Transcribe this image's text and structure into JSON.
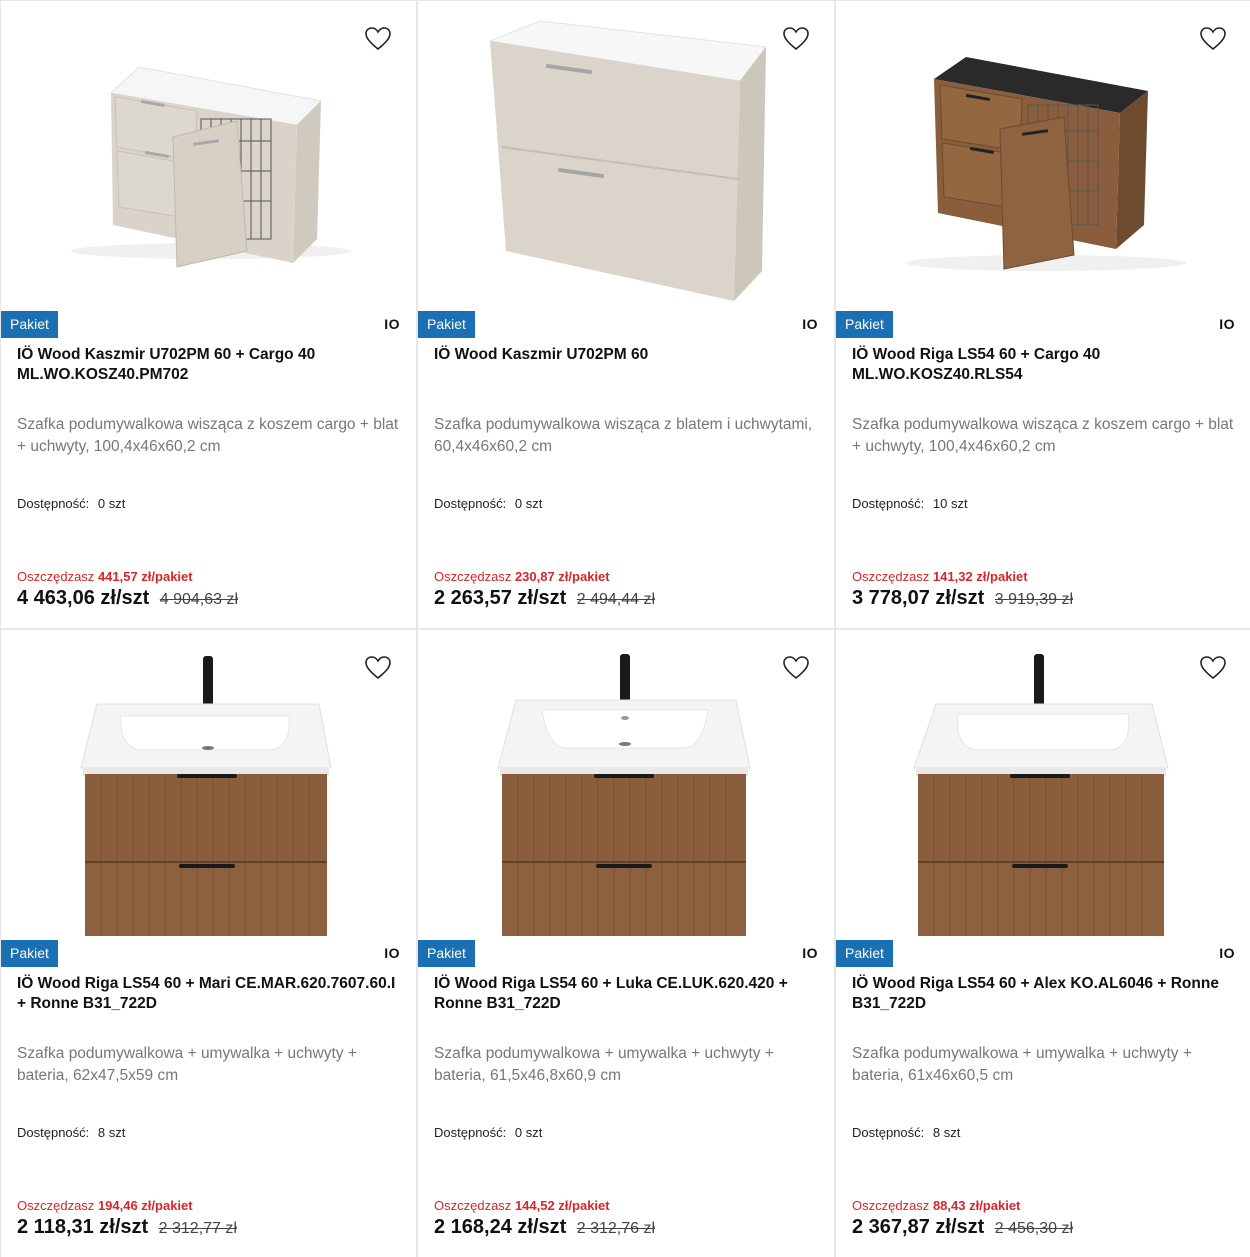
{
  "colors": {
    "badge_bg": "#1b6fb3",
    "save_text": "#d6262a",
    "cashmere": "#d9d3c9",
    "walnut": "#8a5e3c",
    "basalt_top": "#2a2a2a"
  },
  "products": [
    {
      "badge": "Pakiet",
      "brand": "IO",
      "title": "IÖ Wood Kaszmir U702PM 60 + Cargo 40 ML.WO.KOSZ40.PM702",
      "description": "Szafka podumywalkowa wisząca z koszem cargo + blat + uchwyty, 100,4x46x60,2 cm",
      "availability_label": "Dostępność:",
      "availability_value": "0 szt",
      "save_label": "Oszczędzasz",
      "save_value": "441,57 zł/pakiet",
      "price": "4 463,06 zł/szt",
      "old_price": "4 904,63 zł",
      "image": "cargo-cabinet-cashmere"
    },
    {
      "badge": "Pakiet",
      "brand": "IO",
      "title": "IÖ Wood Kaszmir U702PM 60",
      "description": "Szafka podumywalkowa wisząca z blatem i uchwytami, 60,4x46x60,2 cm",
      "availability_label": "Dostępność:",
      "availability_value": "0 szt",
      "save_label": "Oszczędzasz",
      "save_value": "230,87 zł/pakiet",
      "price": "2 263,57 zł/szt",
      "old_price": "2 494,44 zł",
      "image": "drawer-cabinet-cashmere"
    },
    {
      "badge": "Pakiet",
      "brand": "IO",
      "title": "IÖ Wood Riga LS54 60 + Cargo 40 ML.WO.KOSZ40.RLS54",
      "description": "Szafka podumywalkowa wisząca z koszem cargo + blat + uchwyty, 100,4x46x60,2 cm",
      "availability_label": "Dostępność:",
      "availability_value": "10 szt",
      "save_label": "Oszczędzasz",
      "save_value": "141,32 zł/pakiet",
      "price": "3 778,07 zł/szt",
      "old_price": "3 919,39 zł",
      "image": "cargo-cabinet-walnut"
    },
    {
      "badge": "Pakiet",
      "brand": "IO",
      "title": "IÖ Wood Riga LS54 60 + Mari CE.MAR.620.7607.60.I + Ronne B31_722D",
      "description": "Szafka podumywalkowa + umywalka + uchwyty + bateria, 62x47,5x59 cm",
      "availability_label": "Dostępność:",
      "availability_value": "8 szt",
      "save_label": "Oszczędzasz",
      "save_value": "194,46 zł/pakiet",
      "price": "2 118,31 zł/szt",
      "old_price": "2 312,77 zł",
      "image": "vanity-walnut-basin"
    },
    {
      "badge": "Pakiet",
      "brand": "IO",
      "title": "IÖ Wood Riga LS54 60 + Luka CE.LUK.620.420 + Ronne B31_722D",
      "description": "Szafka podumywalkowa + umywalka + uchwyty + bateria, 61,5x46,8x60,9 cm",
      "availability_label": "Dostępność:",
      "availability_value": "0 szt",
      "save_label": "Oszczędzasz",
      "save_value": "144,52 zł/pakiet",
      "price": "2 168,24 zł/szt",
      "old_price": "2 312,76 zł",
      "image": "vanity-walnut-basin"
    },
    {
      "badge": "Pakiet",
      "brand": "IO",
      "title": "IÖ Wood Riga LS54 60 + Alex KO.AL6046 + Ronne B31_722D",
      "description": "Szafka podumywalkowa + umywalka + uchwyty + bateria, 61x46x60,5 cm",
      "availability_label": "Dostępność:",
      "availability_value": "8 szt",
      "save_label": "Oszczędzasz",
      "save_value": "88,43 zł/pakiet",
      "price": "2 367,87 zł/szt",
      "old_price": "2 456,30 zł",
      "image": "vanity-walnut-basin"
    }
  ]
}
